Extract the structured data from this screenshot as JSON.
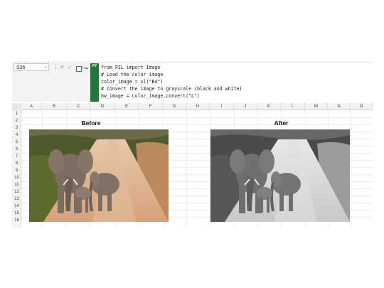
{
  "formula_bar": {
    "cell_reference": "S36",
    "dropdown_glyph": "⌄",
    "menu_glyph": "⋮",
    "cancel_glyph": "✕",
    "enter_glyph": "✓",
    "python_badge": "PY",
    "code_lines": [
      "from PIL import Image",
      "# Load the color image",
      "color_image = xl(\"B4\")",
      "# Convert the image to grayscale (black and white)",
      "bw_image = color_image.convert(\"L\")"
    ]
  },
  "grid": {
    "columns": [
      "A",
      "B",
      "C",
      "D",
      "E",
      "F",
      "G",
      "H",
      "I",
      "J",
      "K",
      "L",
      "M",
      "N",
      "O"
    ],
    "rows": [
      "1",
      "2",
      "3",
      "4",
      "5",
      "6",
      "7",
      "8",
      "9",
      "10",
      "11",
      "12",
      "13",
      "14",
      "15",
      "16"
    ]
  },
  "images": {
    "before_title": "Before",
    "after_title": "After"
  },
  "colors": {
    "python_green": "#1f7a3a"
  }
}
